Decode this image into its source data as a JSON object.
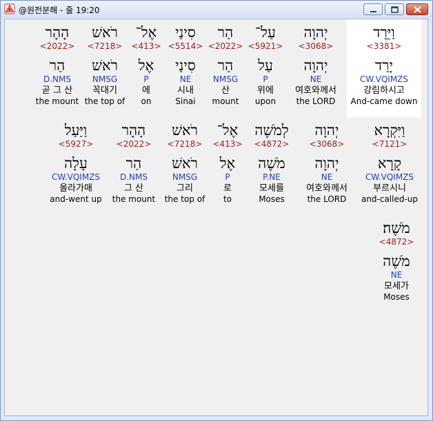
{
  "window": {
    "title": "@원전분해 - 줄 19:20"
  },
  "rows": [
    [
      {
        "heb": "וַיֵּרֶד",
        "strong": "<3381>",
        "heb2": "יָרַד",
        "morph": "CW.VQIMZS",
        "kor": "강림하시고",
        "eng": "And-came down",
        "highlight": true
      },
      {
        "heb": "יְהוָה",
        "strong": "<3068>",
        "heb2": "יְהוָה",
        "morph": "NE",
        "kor": "여호와께서",
        "eng": "the LORD"
      },
      {
        "heb": "עַל־",
        "strong": "<5921>",
        "heb2": "עַל",
        "morph": "P",
        "kor": "위에",
        "eng": "upon"
      },
      {
        "heb": "הַר",
        "strong": "<2022>",
        "heb2": "הַר",
        "morph": "NMSG",
        "kor": "산",
        "eng": "mount"
      },
      {
        "heb": "סִינַי",
        "strong": "<5514>",
        "heb2": "סִינַי",
        "morph": "NE",
        "kor": "시내",
        "eng": "Sinai"
      },
      {
        "heb": "אֶל־",
        "strong": "<413>",
        "heb2": "אֶל",
        "morph": "P",
        "kor": "에",
        "eng": "on"
      },
      {
        "heb": "רֹאשׁ",
        "strong": "<7218>",
        "heb2": "רֹאשׁ",
        "morph": "NMSG",
        "kor": "꼭대기",
        "eng": "the top of"
      },
      {
        "heb": "הָהָר",
        "strong": "<2022>",
        "heb2": "הַר",
        "morph": "D.NMS",
        "kor": "곧 그 산",
        "eng": "the mount"
      }
    ],
    [
      {
        "heb": "וַיִּקְרָא",
        "strong": "<7121>",
        "heb2": "קָרָא",
        "morph": "CW.VQIMZS",
        "kor": "부르시니",
        "eng": "and-called-up"
      },
      {
        "heb": "יְהוָה",
        "strong": "<3068>",
        "heb2": "יְהוָה",
        "morph": "NE",
        "kor": "여호와께서",
        "eng": "the LORD"
      },
      {
        "heb": "לְמֹשֶׁה",
        "strong": "<4872>",
        "heb2": "מֹשֶׁה",
        "morph": "P.NE",
        "kor": "모세를",
        "eng": "Moses"
      },
      {
        "heb": "אֶל־",
        "strong": "<413>",
        "heb2": "אֶל",
        "morph": "P",
        "kor": "로",
        "eng": "to"
      },
      {
        "heb": "רֹאשׁ",
        "strong": "<7218>",
        "heb2": "רֹאשׁ",
        "morph": "NMSG",
        "kor": "그리",
        "eng": "the top of"
      },
      {
        "heb": "הָהָר",
        "strong": "<2022>",
        "heb2": "הַר",
        "morph": "D.NMS",
        "kor": "그 산",
        "eng": "the mount"
      },
      {
        "heb": "וַיַּעַל",
        "strong": "<5927>",
        "heb2": "עָלָה",
        "morph": "CW.VQIMZS",
        "kor": "올라가매",
        "eng": "and-went up"
      }
    ],
    [
      {
        "heb": "מֹשֶׁה׃",
        "strong": "<4872>",
        "heb2": "מֹשֶׁה",
        "morph": "NE",
        "kor": "모세가",
        "eng": "Moses"
      }
    ]
  ]
}
